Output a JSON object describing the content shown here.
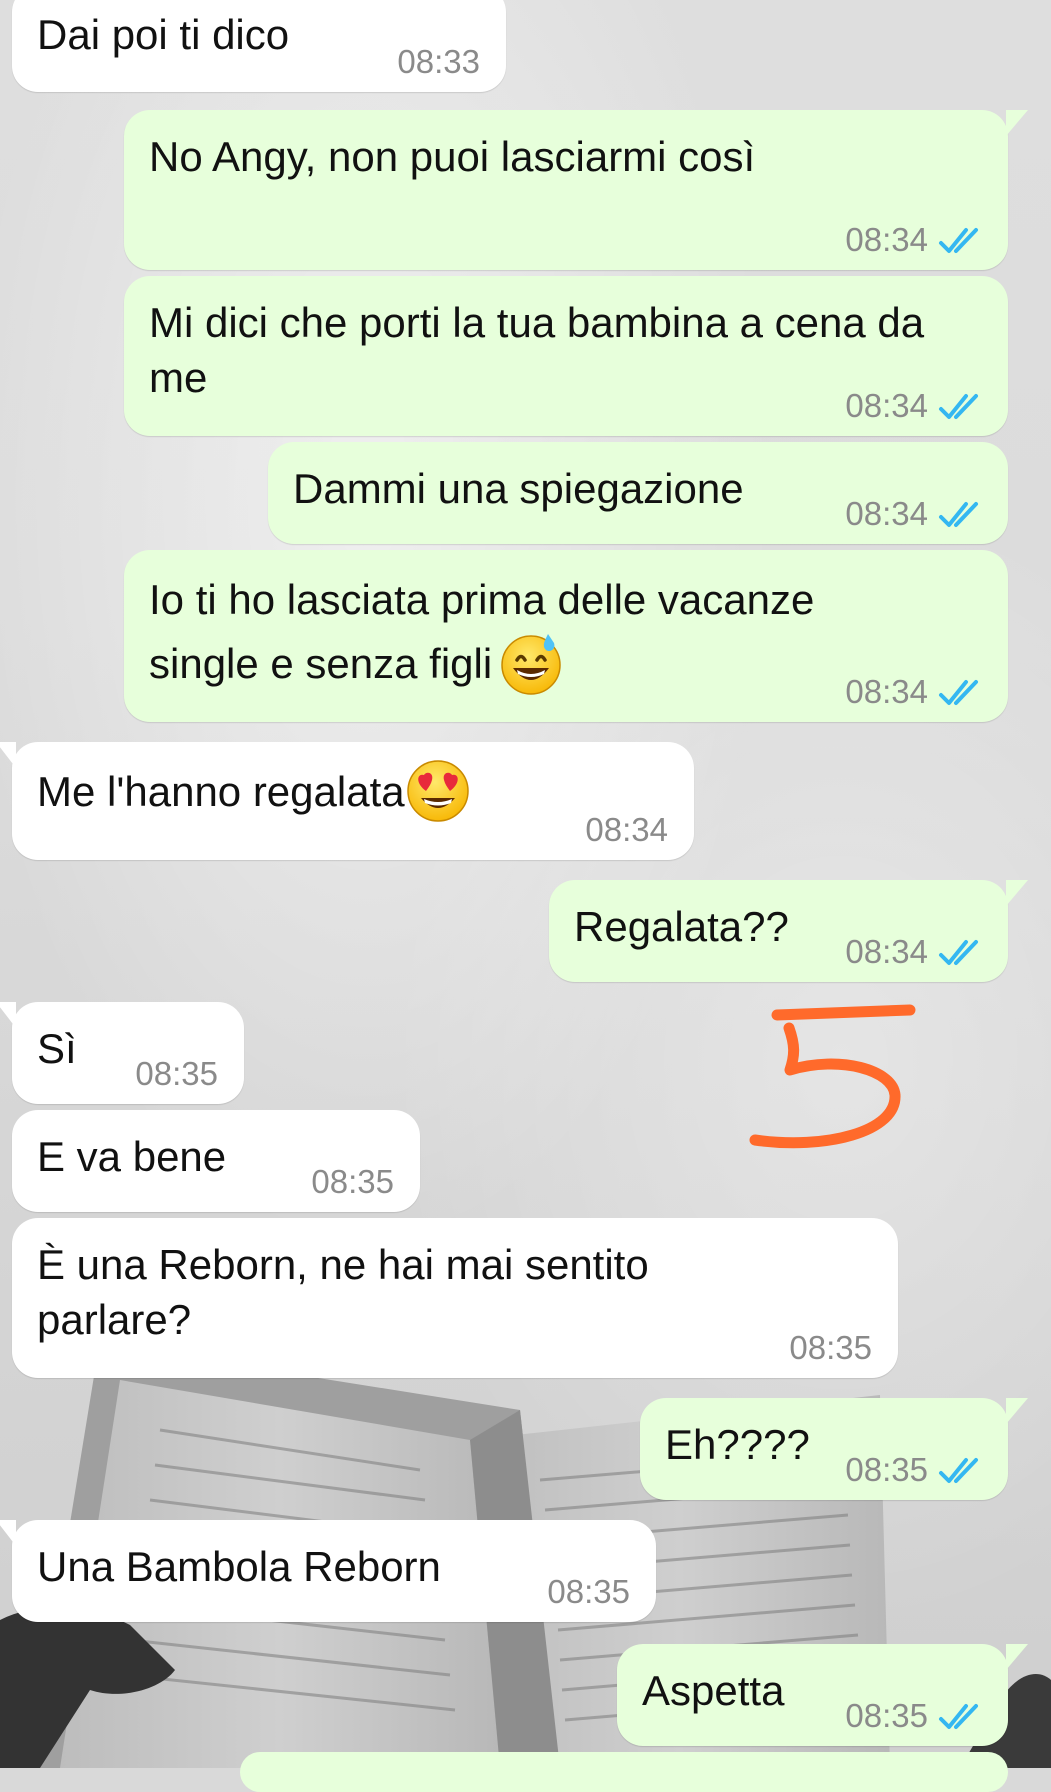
{
  "chat": {
    "messages": [
      {
        "dir": "in",
        "text": "Dai poi ti dico",
        "time": "08:33"
      },
      {
        "dir": "out",
        "text": "No Angy, non puoi lasciarmi così",
        "time": "08:34"
      },
      {
        "dir": "out",
        "text": "Mi dici che porti la tua bambina a cena da me",
        "time": "08:34"
      },
      {
        "dir": "out",
        "text": "Dammi una spiegazione",
        "time": "08:34"
      },
      {
        "dir": "out",
        "text": "Io ti ho lasciata prima delle vacanze single e senza figli",
        "emoji": "grinning-sweat-emoji",
        "time": "08:34"
      },
      {
        "dir": "in",
        "text": "Me l'hanno regalata",
        "emoji": "heart-eyes-emoji",
        "time": "08:34"
      },
      {
        "dir": "out",
        "text": "Regalata??",
        "time": "08:34"
      },
      {
        "dir": "in",
        "text": "Sì",
        "time": "08:35"
      },
      {
        "dir": "in",
        "text": "E va bene",
        "time": "08:35"
      },
      {
        "dir": "in",
        "text": "È una Reborn, ne hai mai sentito parlare?",
        "time": "08:35"
      },
      {
        "dir": "out",
        "text": "Eh????",
        "time": "08:35"
      },
      {
        "dir": "in",
        "text": "Una Bambola Reborn",
        "time": "08:35"
      },
      {
        "dir": "out",
        "text": "Aspetta",
        "time": "08:35"
      }
    ]
  },
  "colors": {
    "incoming_bubble": "#ffffff",
    "outgoing_bubble": "#e7ffdb",
    "timestamp": "#8a8a8a",
    "read_ticks": "#34b7f1",
    "annotation": "#ff6a2b"
  },
  "annotation": {
    "icon": "hand-drawn-five-scribble"
  },
  "read_status": "double-check-read"
}
